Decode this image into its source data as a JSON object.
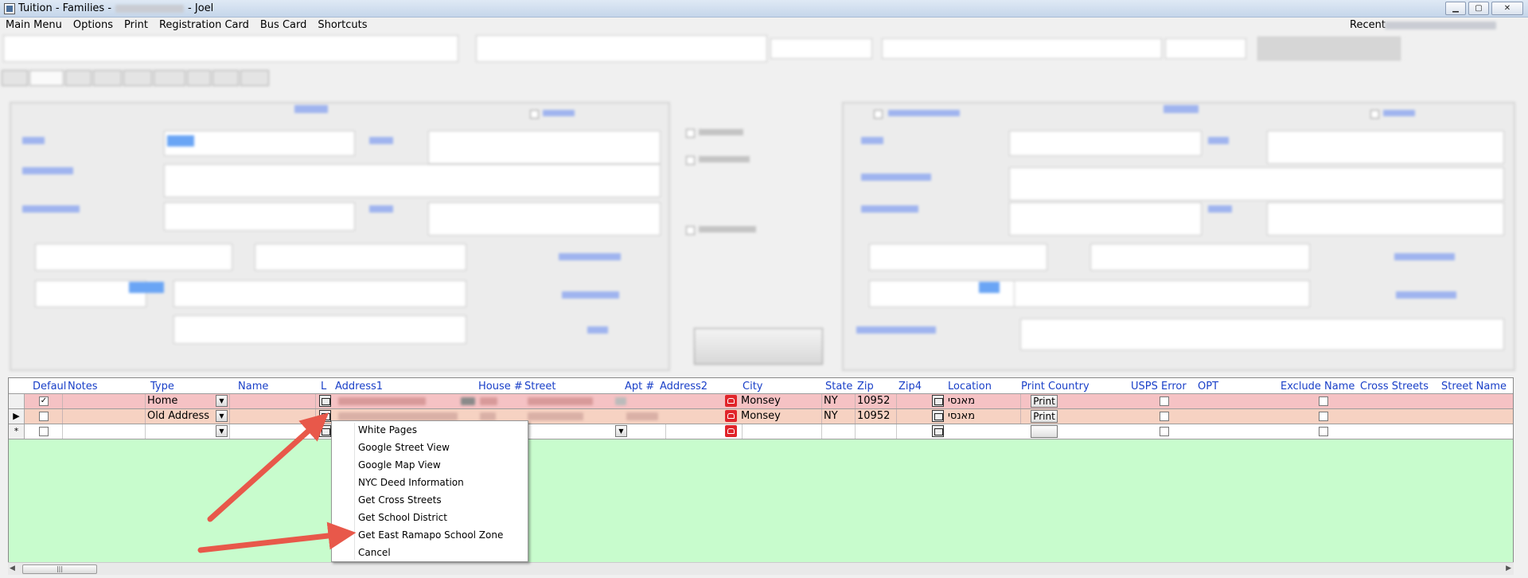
{
  "window": {
    "title_prefix": "Tuition - Families -",
    "title_user": "- Joel",
    "buttons": [
      "minimize",
      "maximize",
      "close"
    ]
  },
  "menubar": {
    "items": [
      "Main Menu",
      "Options",
      "Print",
      "Registration Card",
      "Bus Card",
      "Shortcuts"
    ],
    "recent_label": "Recent"
  },
  "grid": {
    "columns": {
      "default": "Defaul",
      "notes": "Notes",
      "type": "Type",
      "name": "Name",
      "l": "L",
      "address1": "Address1",
      "house": "House #",
      "street": "Street",
      "apt": "Apt #",
      "address2": "Address2",
      "city": "City",
      "state": "State",
      "zip": "Zip",
      "zip4": "Zip4",
      "location": "Location",
      "print": "Print",
      "country": "Country",
      "usps_error": "USPS Error",
      "opt": "OPT",
      "exclude_name": "Exclude Name",
      "cross_streets": "Cross Streets",
      "street_name": "Street Name"
    },
    "rows": [
      {
        "default_checked": "✓",
        "type": "Home",
        "city": "Monsey",
        "state": "NY",
        "zip": "10952",
        "location": "מאנסי",
        "print": "Print"
      },
      {
        "default_checked": "",
        "type": "Old Address",
        "city": "Monsey",
        "state": "NY",
        "zip": "10952",
        "location": "מאנסי",
        "print": "Print"
      }
    ],
    "new_row_marker": "*",
    "current_row_marker": "▶"
  },
  "context_menu": {
    "items": [
      "White Pages",
      "Google Street View",
      "Google Map View",
      "NYC Deed Information",
      "Get Cross Streets",
      "Get School District",
      "Get East Ramapo School Zone",
      "Cancel"
    ]
  },
  "colors": {
    "header_text": "#1a40c8",
    "row_home_bg": "#f5c2c4",
    "row_old_bg": "#f6d2c2",
    "grid_bg": "#c8fccd",
    "arrow": "#e8584a"
  }
}
